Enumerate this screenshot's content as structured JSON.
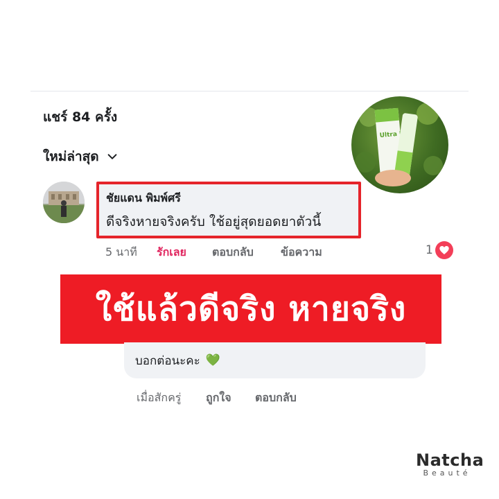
{
  "post": {
    "shares": "แชร์ 84 ครั้ง",
    "sort_label": "ใหม่ล่าสุด"
  },
  "comment1": {
    "author": "ชัยแดน พิมพ์ศรี",
    "text": "ดีจริงหายจริงครับ ใช้อยู่สุดยอดยาตัวนี้",
    "time": "5 นาที",
    "love": "รักเลย",
    "reply": "ตอบกลับ",
    "message": "ข้อความ",
    "reaction_count": "1"
  },
  "banner": {
    "text": "ใช้แล้วดีจริง หายจริง"
  },
  "comment2": {
    "text": "บอกต่อนะคะ",
    "emoji": "💚",
    "time": "เมื่อสักครู่",
    "like": "ถูกใจ",
    "reply": "ตอบกลับ"
  },
  "brand": {
    "name": "Natcha",
    "sub": "Beauté",
    "product_label": "Ultra U"
  },
  "colors": {
    "highlight_red": "#ee1c25",
    "love_pink": "#e0245e",
    "brand_green": "#7cc242"
  }
}
